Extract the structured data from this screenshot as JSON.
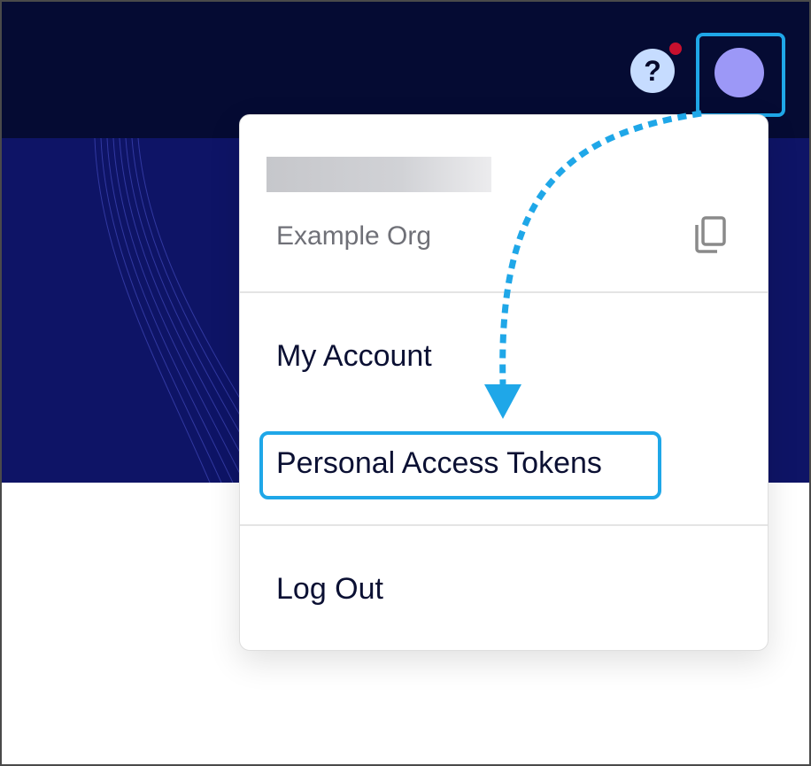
{
  "header": {
    "help_icon": "question-mark-icon",
    "help_label": "?",
    "notification": true,
    "avatar_icon": "user-avatar"
  },
  "menu": {
    "org_name": "Example Org",
    "copy_icon": "copy-icon",
    "items": [
      {
        "label": "My Account"
      },
      {
        "label": "Personal Access Tokens"
      },
      {
        "label": "Log Out"
      }
    ]
  },
  "colors": {
    "highlight": "#1fa7e8",
    "topbar": "#050b33",
    "hero": "#0e1466",
    "avatar": "#9c98f7"
  }
}
